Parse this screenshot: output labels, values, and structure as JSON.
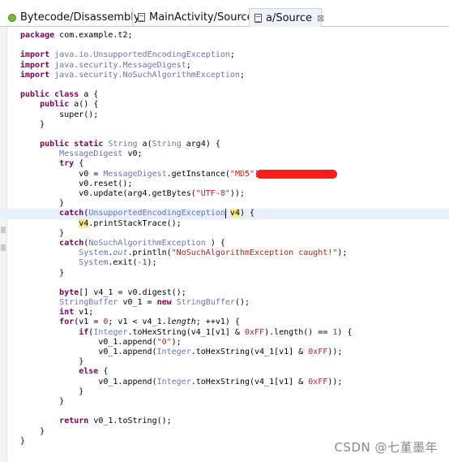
{
  "tabs": [
    {
      "label": "Bytecode/Disassembly",
      "icon": "bug-icon"
    },
    {
      "label": "MainActivity/Source",
      "icon": "file-icon"
    },
    {
      "label": "a/Source",
      "icon": "file-icon",
      "active": true,
      "close": "⊠"
    }
  ],
  "code": [
    [
      [
        "kw",
        "package"
      ],
      [
        "pl",
        " com.example.t2;"
      ]
    ],
    [],
    [
      [
        "kw",
        "import"
      ],
      [
        "pl",
        " "
      ],
      [
        "ty",
        "java.io.UnsupportedEncodingException"
      ],
      [
        "pl",
        ";"
      ]
    ],
    [
      [
        "kw",
        "import"
      ],
      [
        "pl",
        " "
      ],
      [
        "ty",
        "java.security.MessageDigest"
      ],
      [
        "pl",
        ";"
      ]
    ],
    [
      [
        "kw",
        "import"
      ],
      [
        "pl",
        " "
      ],
      [
        "ty",
        "java.security.NoSuchAlgorithmException"
      ],
      [
        "pl",
        ";"
      ]
    ],
    [],
    [
      [
        "kw",
        "public class"
      ],
      [
        "pl",
        " a {"
      ]
    ],
    [
      [
        "pl",
        "    "
      ],
      [
        "kw",
        "public"
      ],
      [
        "pl",
        " a() {"
      ]
    ],
    [
      [
        "pl",
        "        super();"
      ]
    ],
    [
      [
        "pl",
        "    }"
      ]
    ],
    [],
    [
      [
        "pl",
        "    "
      ],
      [
        "kw",
        "public static"
      ],
      [
        "pl",
        " "
      ],
      [
        "ty",
        "String"
      ],
      [
        "pl",
        " a("
      ],
      [
        "ty",
        "String"
      ],
      [
        "pl",
        " arg4) {"
      ]
    ],
    [
      [
        "pl",
        "        "
      ],
      [
        "ty",
        "MessageDigest"
      ],
      [
        "pl",
        " v0;"
      ]
    ],
    [
      [
        "pl",
        "        "
      ],
      [
        "kw",
        "try"
      ],
      [
        "pl",
        " {"
      ]
    ],
    [
      [
        "pl",
        "            v0 = "
      ],
      [
        "ty",
        "MessageDigest"
      ],
      [
        "pl",
        ".getInstance("
      ],
      [
        "st",
        "\"MD5\""
      ],
      [
        "pl",
        ");"
      ]
    ],
    [
      [
        "pl",
        "            v0.reset();"
      ]
    ],
    [
      [
        "pl",
        "            v0.update(arg4.getBytes("
      ],
      [
        "st",
        "\"UTF-8\""
      ],
      [
        "pl",
        "));"
      ]
    ],
    [
      [
        "pl",
        "        }"
      ]
    ],
    [
      [
        "pl",
        "        "
      ],
      [
        "kw",
        "catch"
      ],
      [
        "pl",
        "("
      ],
      [
        "ty",
        "UnsupportedEncodingException"
      ],
      [
        "pl",
        " "
      ],
      [
        "hw",
        "v4"
      ],
      [
        "pl",
        ") {"
      ]
    ],
    [
      [
        "pl",
        "            "
      ],
      [
        "hw",
        "v4"
      ],
      [
        "pl",
        ".printStackTrace();"
      ]
    ],
    [
      [
        "pl",
        "        }"
      ]
    ],
    [
      [
        "pl",
        "        "
      ],
      [
        "kw",
        "catch"
      ],
      [
        "pl",
        "("
      ],
      [
        "ty",
        "NoSuchAlgorithmException"
      ],
      [
        "pl",
        " ) {"
      ]
    ],
    [
      [
        "pl",
        "            "
      ],
      [
        "ty",
        "System"
      ],
      [
        "pl",
        "."
      ],
      [
        "ti",
        "out"
      ],
      [
        "pl",
        ".println("
      ],
      [
        "st",
        "\"NoSuchAlgorithmException caught!\""
      ],
      [
        "pl",
        ");"
      ]
    ],
    [
      [
        "pl",
        "            "
      ],
      [
        "ty",
        "System"
      ],
      [
        "pl",
        ".exit("
      ],
      [
        "nm",
        "-1"
      ],
      [
        "pl",
        ");"
      ]
    ],
    [
      [
        "pl",
        "        }"
      ]
    ],
    [],
    [
      [
        "pl",
        "        "
      ],
      [
        "kw",
        "byte"
      ],
      [
        "pl",
        "[] v4_1 = v0.digest();"
      ]
    ],
    [
      [
        "pl",
        "        "
      ],
      [
        "ty",
        "StringBuffer"
      ],
      [
        "pl",
        " v0_1 = "
      ],
      [
        "kw",
        "new"
      ],
      [
        "pl",
        " "
      ],
      [
        "ty",
        "StringBuffer"
      ],
      [
        "pl",
        "();"
      ]
    ],
    [
      [
        "pl",
        "        "
      ],
      [
        "kw",
        "int"
      ],
      [
        "pl",
        " v1;"
      ]
    ],
    [
      [
        "pl",
        "        "
      ],
      [
        "kw",
        "for"
      ],
      [
        "pl",
        "(v1 = "
      ],
      [
        "nm",
        "0"
      ],
      [
        "pl",
        "; v1 < v4_1."
      ],
      [
        "it",
        "length"
      ],
      [
        "pl",
        "; ++v1) {"
      ]
    ],
    [
      [
        "pl",
        "            "
      ],
      [
        "kw",
        "if"
      ],
      [
        "pl",
        "("
      ],
      [
        "ty",
        "Integer"
      ],
      [
        "pl",
        ".toHexString(v4_1[v1] & "
      ],
      [
        "nm",
        "0xFF"
      ],
      [
        "pl",
        ").length() == "
      ],
      [
        "nm",
        "1"
      ],
      [
        "pl",
        ") {"
      ]
    ],
    [
      [
        "pl",
        "                v0_1.append("
      ],
      [
        "st",
        "\"0\""
      ],
      [
        "pl",
        ");"
      ]
    ],
    [
      [
        "pl",
        "                v0_1.append("
      ],
      [
        "ty",
        "Integer"
      ],
      [
        "pl",
        ".toHexString(v4_1[v1] & "
      ],
      [
        "nm",
        "0xFF"
      ],
      [
        "pl",
        "));"
      ]
    ],
    [
      [
        "pl",
        "            }"
      ]
    ],
    [
      [
        "pl",
        "            "
      ],
      [
        "kw",
        "else"
      ],
      [
        "pl",
        " {"
      ]
    ],
    [
      [
        "pl",
        "                v0_1.append("
      ],
      [
        "ty",
        "Integer"
      ],
      [
        "pl",
        ".toHexString(v4_1[v1] & "
      ],
      [
        "nm",
        "0xFF"
      ],
      [
        "pl",
        "));"
      ]
    ],
    [
      [
        "pl",
        "            }"
      ]
    ],
    [
      [
        "pl",
        "        }"
      ]
    ],
    [],
    [
      [
        "pl",
        "        "
      ],
      [
        "kw",
        "return"
      ],
      [
        "pl",
        " v0_1.toString();"
      ]
    ],
    [
      [
        "pl",
        "    }"
      ]
    ],
    [
      [
        "pl",
        "}"
      ]
    ]
  ],
  "highlight_line_index": 18,
  "watermark": "CSDN @七堇墨年",
  "colors": {
    "keyword": "#7f0055",
    "type": "#6b74b8",
    "string": "#c02020",
    "current_line": "#e8f0fd",
    "redaction": "#ff1c1c"
  }
}
